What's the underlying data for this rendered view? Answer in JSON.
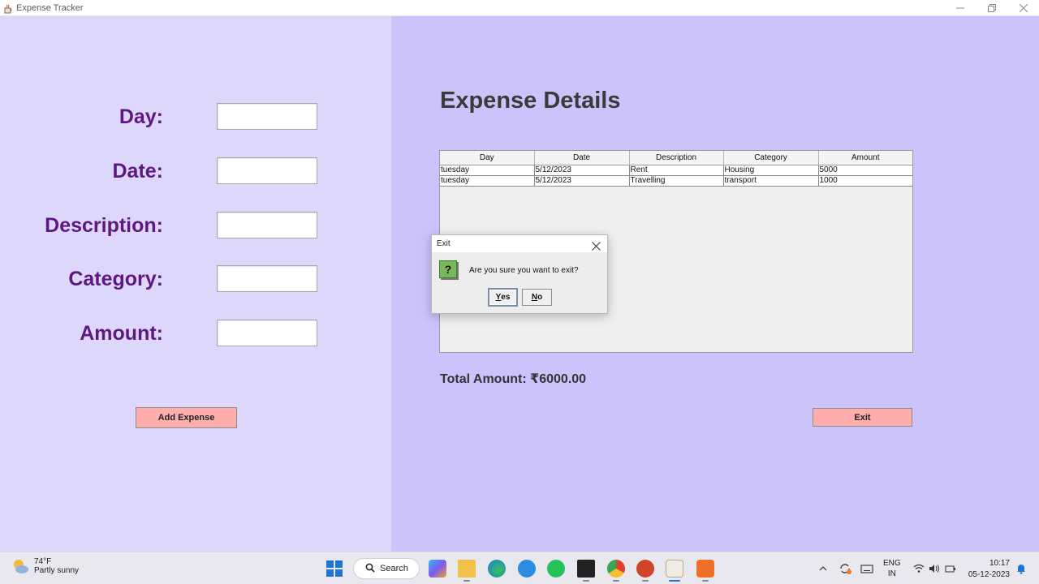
{
  "window": {
    "title": "Expense Tracker",
    "controls": [
      "minimize",
      "restore",
      "close"
    ]
  },
  "form": {
    "day_label": "Day:",
    "date_label": "Date:",
    "description_label": "Description:",
    "category_label": "Category:",
    "amount_label": "Amount:",
    "day_value": "",
    "date_value": "",
    "description_value": "",
    "category_value": "",
    "amount_value": "",
    "add_button": "Add Expense"
  },
  "details": {
    "heading": "Expense Details",
    "columns": [
      "Day",
      "Date",
      "Description",
      "Category",
      "Amount"
    ],
    "rows": [
      [
        "tuesday",
        "5/12/2023",
        "Rent",
        "Housing",
        "5000"
      ],
      [
        "tuesday",
        "5/12/2023",
        "Travelling",
        "transport",
        "1000"
      ]
    ],
    "total": "Total Amount: ₹6000.00",
    "exit_button": "Exit"
  },
  "dialog": {
    "title": "Exit",
    "message": "Are you sure you want to exit?",
    "yes_mnemonic": "Y",
    "yes_rest": "es",
    "no_mnemonic": "N",
    "no_rest": "o",
    "icon": "question-icon"
  },
  "taskbar": {
    "weather_temp": "74°F",
    "weather_desc": "Partly sunny",
    "search_label": "Search",
    "lang_line1": "ENG",
    "lang_line2": "IN",
    "time": "10:17",
    "date": "05-12-2023"
  },
  "colors": {
    "left_bg": "#ddd7fb",
    "right_bg": "#cdc3fb",
    "label_purple": "#5e1880",
    "button_pink": "#ffadad"
  }
}
